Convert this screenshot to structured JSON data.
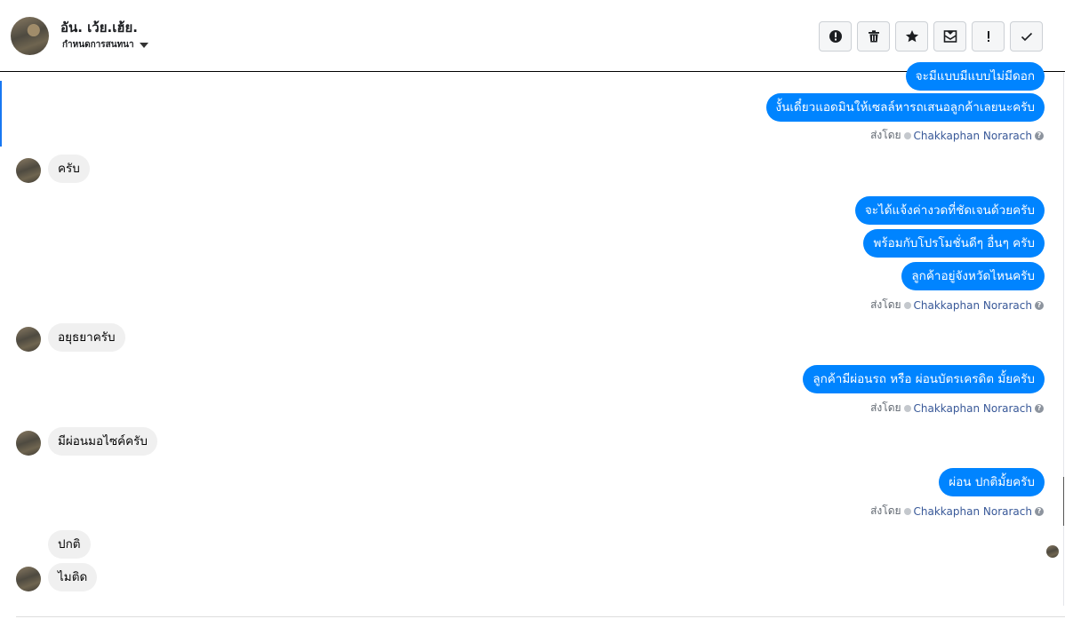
{
  "header": {
    "name": "อัน. เว้ย.เฮ้ย.",
    "subtitle": "กำหนดการสนทนา",
    "toolbar": [
      {
        "icon": "alert-circle-icon"
      },
      {
        "icon": "trash-icon"
      },
      {
        "icon": "star-icon"
      },
      {
        "icon": "mark-unread-icon"
      },
      {
        "icon": "exclamation-icon"
      },
      {
        "icon": "check-icon"
      }
    ]
  },
  "sent_by": {
    "prefix": "ส่งโดย",
    "name": "Chakkaphan Norarach",
    "help": "?"
  },
  "messages": [
    {
      "dir": "out",
      "text": "จะมีแบบมีแบบไม่มีดอก"
    },
    {
      "dir": "out",
      "text": "งั้นเดี๋ยวแอดมินให้เซลล์หารถเสนอลูกค้าเลยนะครับ"
    },
    {
      "dir": "in",
      "text": "ครับ"
    },
    {
      "dir": "out",
      "text": "จะได้แจ้งค่างวดที่ชัดเจนด้วยครับ"
    },
    {
      "dir": "out",
      "text": "พร้อมกับโปรโมชั่นดีๆ อื่นๆ ครับ"
    },
    {
      "dir": "out",
      "text": "ลูกค้าอยู่จังหวัดไหนครับ"
    },
    {
      "dir": "in",
      "text": "อยุธยาครับ"
    },
    {
      "dir": "out",
      "text": "ลูกค้ามีผ่อนรถ หรือ ผ่อนบัตรเครดิต มั้ยครับ"
    },
    {
      "dir": "in",
      "text": "มีผ่อนมอไซค์ครับ"
    },
    {
      "dir": "out",
      "text": "ผ่อน ปกติมั้ยครับ"
    },
    {
      "dir": "in",
      "text": "ปกติ"
    },
    {
      "dir": "in",
      "text": "ไมติด"
    }
  ],
  "colors": {
    "outgoing": "#0084ff",
    "incoming": "#f0f0f0",
    "link": "#385898",
    "accent": "#1877f2"
  }
}
